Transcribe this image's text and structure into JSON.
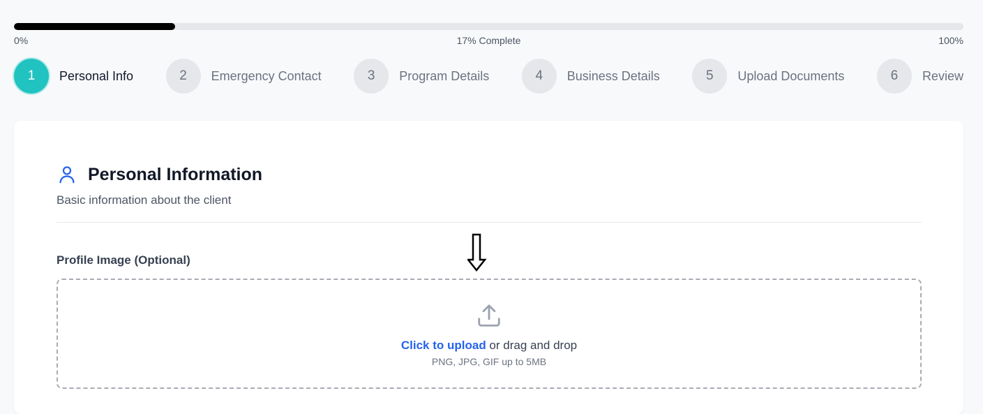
{
  "progress": {
    "percent": 17,
    "start_label": "0%",
    "status_label": "17% Complete",
    "end_label": "100%"
  },
  "steps": [
    {
      "number": "1",
      "label": "Personal Info",
      "active": true
    },
    {
      "number": "2",
      "label": "Emergency Contact",
      "active": false
    },
    {
      "number": "3",
      "label": "Program Details",
      "active": false
    },
    {
      "number": "4",
      "label": "Business Details",
      "active": false
    },
    {
      "number": "5",
      "label": "Upload Documents",
      "active": false
    },
    {
      "number": "6",
      "label": "Review",
      "active": false
    }
  ],
  "section": {
    "icon": "user-icon",
    "title": "Personal Information",
    "subtitle": "Basic information about the client"
  },
  "profile_image": {
    "label": "Profile Image (Optional)",
    "icon": "upload-icon",
    "link_text": "Click to upload",
    "rest_text": " or drag and drop",
    "hint": "PNG, JPG, GIF up to 5MB"
  },
  "colors": {
    "accent": "#20c3c0",
    "link": "#2563eb",
    "progress_fill": "#000000"
  }
}
